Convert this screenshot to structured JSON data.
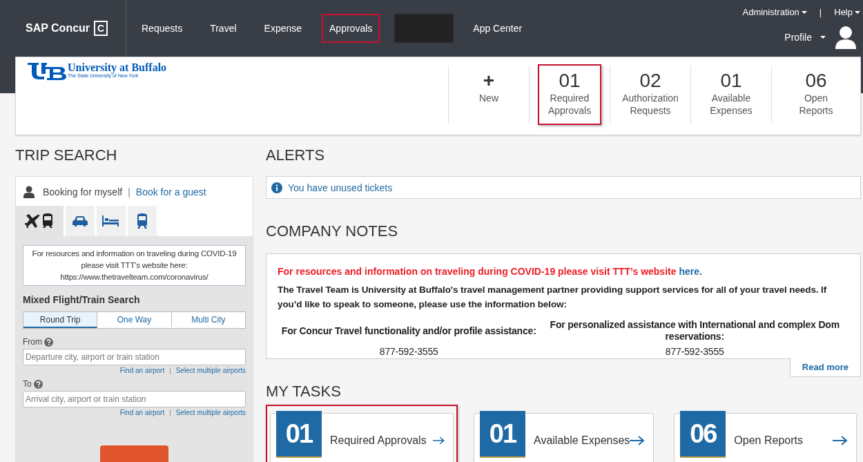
{
  "header": {
    "logo": "SAP Concur",
    "logo_mark": "C",
    "nav": [
      {
        "kind": "link",
        "label": "Requests",
        "highlighted": false
      },
      {
        "kind": "link",
        "label": "Travel",
        "highlighted": false
      },
      {
        "kind": "link",
        "label": "Expense",
        "highlighted": false
      },
      {
        "kind": "link",
        "label": "Approvals",
        "highlighted": true
      },
      {
        "kind": "redacted"
      },
      {
        "kind": "link",
        "label": "App Center",
        "highlighted": false
      }
    ],
    "admin": "Administration",
    "separator": "|",
    "help": "Help",
    "profile": "Profile"
  },
  "org": {
    "name": "University at Buffalo",
    "subtitle": "The State University of New York"
  },
  "quick_actions": [
    {
      "kind": "new",
      "icon": "+",
      "label": "New",
      "highlighted": false
    },
    {
      "kind": "count",
      "count": "01",
      "label": "Required Approvals",
      "highlighted": true
    },
    {
      "kind": "count",
      "count": "02",
      "label": "Authorization Requests",
      "highlighted": false
    },
    {
      "kind": "count",
      "count": "01",
      "label": "Available Expenses",
      "highlighted": false
    },
    {
      "kind": "count",
      "count": "06",
      "label": "Open Reports",
      "highlighted": false
    }
  ],
  "trip_search": {
    "title": "TRIP SEARCH",
    "booking_self": "Booking for myself",
    "separator": "|",
    "book_guest": "Book for a guest",
    "modes": [
      {
        "kind": "flight-train",
        "selected": true
      },
      {
        "kind": "car",
        "selected": false
      },
      {
        "kind": "hotel",
        "selected": false
      },
      {
        "kind": "rail",
        "selected": false
      }
    ],
    "notice": "For resources and information on traveling during COVID-19 please visit TTT's website here: https://www.thetravelteam.com/coronavirus/",
    "search_title": "Mixed Flight/Train Search",
    "trip_types": [
      {
        "label": "Round Trip",
        "selected": true
      },
      {
        "label": "One Way",
        "selected": false
      },
      {
        "label": "Multi City",
        "selected": false
      }
    ],
    "fields": [
      {
        "label": "From",
        "placeholder": "Departure city, airport or train station",
        "link_1": "Find an airport",
        "separator": "|",
        "link_2": "Select multiple airports"
      },
      {
        "label": "To",
        "placeholder": "Arrival city, airport or train station",
        "link_1": "Find an airport",
        "separator": "|",
        "link_2": "Select multiple airports"
      }
    ]
  },
  "alerts": {
    "title": "ALERTS",
    "items": [
      "You have unused tickets"
    ]
  },
  "company_notes": {
    "title": "COMPANY NOTES",
    "headline": "For resources and information on traveling during COVID-19 please visit TTT’s website",
    "headline_link": "here.",
    "body": "The Travel Team is University at Buffalo's travel management partner providing support services for all of your travel needs. If you’d like to speak to someone, please use the information below:",
    "contacts": [
      {
        "label": "For Concur Travel functionality and/or profile assistance:",
        "phone": "877-592-3555"
      },
      {
        "label": "For personalized assistance with International and complex Dom reservations:",
        "phone": "877-592-3555"
      }
    ],
    "read_more": "Read more"
  },
  "my_tasks": {
    "title": "MY TASKS",
    "tasks": [
      {
        "count": "01",
        "label": "Required Approvals",
        "highlighted": true
      },
      {
        "count": "01",
        "label": "Available Expenses",
        "highlighted": false
      },
      {
        "count": "06",
        "label": "Open Reports",
        "highlighted": false
      }
    ]
  }
}
